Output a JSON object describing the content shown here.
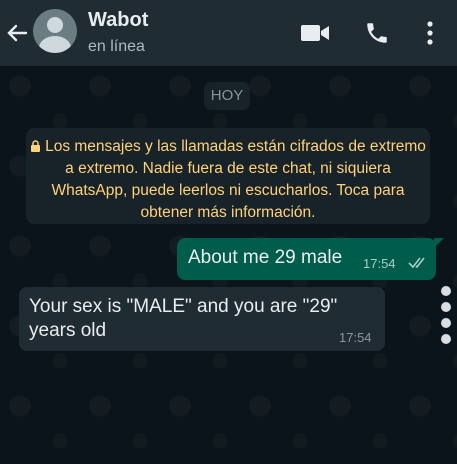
{
  "header": {
    "title": "Wabot",
    "status": "en línea",
    "icons": [
      "back-arrow-icon",
      "video-call-icon",
      "phone-icon",
      "more-menu-icon"
    ]
  },
  "chat": {
    "date_chip": "HOY",
    "encryption_notice": "Los mensajes y las llamadas están cifrados de extremo a extremo. Nadie fuera de este chat, ni siquiera WhatsApp, puede leerlos ni escucharlos. Toca para obtener más información.",
    "messages": [
      {
        "direction": "out",
        "text": "About me 29 male",
        "time": "17:54",
        "status": "read"
      },
      {
        "direction": "in",
        "text": "Your sex is \"MALE\" and you are \"29\" years old",
        "time": "17:54"
      }
    ]
  },
  "colors": {
    "header_bg": "#1f2c33",
    "wall_bg": "#0b141a",
    "outgoing_bubble": "#005c4b",
    "incoming_bubble": "#202c33",
    "notice_text": "#ffd279"
  }
}
